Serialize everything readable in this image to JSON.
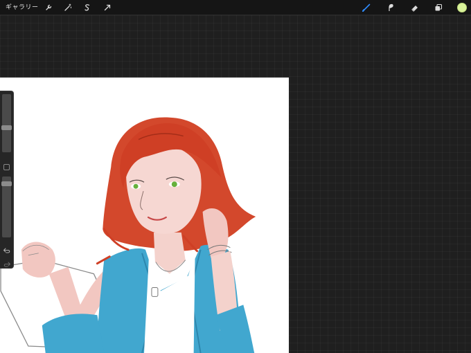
{
  "toolbar": {
    "gallery_label": "ギャラリー",
    "left_tools": [
      "wrench-icon",
      "magic-wand-icon",
      "selection-icon",
      "transform-icon"
    ],
    "right_tools": [
      "brush-icon",
      "smudge-icon",
      "eraser-icon",
      "layers-icon"
    ],
    "active_tool": "brush-icon",
    "accent_color": "#2f8cff",
    "current_color": "#d9f29a"
  },
  "sidebar": {
    "brush_size": 0.53,
    "opacity": 0.87
  },
  "canvas": {
    "background": "#ffffff",
    "artwork": "illustration"
  }
}
